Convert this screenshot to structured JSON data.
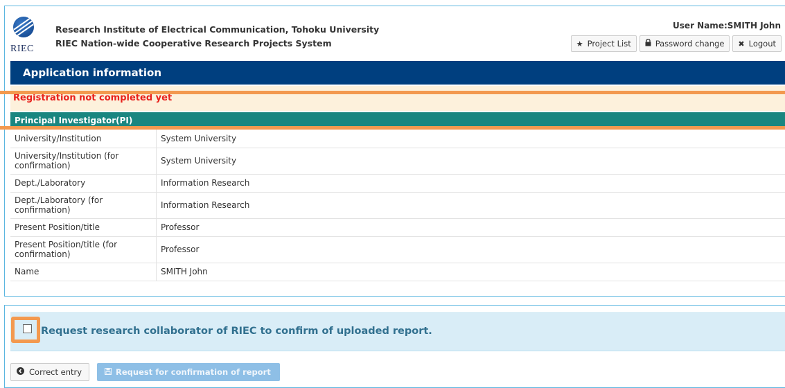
{
  "header": {
    "logo_text": "RIEC",
    "institute": "Research Institute of Electrical Communication, Tohoku University",
    "system_name": "RIEC Nation-wide Cooperative Research Projects System",
    "user_label": "User Name:SMITH John",
    "buttons": {
      "project_list": "Project List",
      "password_change": "Password change",
      "logout": "Logout"
    },
    "icons": {
      "project_list": "star-icon",
      "password_change": "lock-icon",
      "logout": "close-icon"
    }
  },
  "page_title": "Application information",
  "warning": "Registration not completed yet",
  "section_title": "Principal Investigator(PI)",
  "rows": [
    {
      "label": "University/Institution",
      "value": "System University"
    },
    {
      "label": "University/Institution (for confirmation)",
      "value": "System University"
    },
    {
      "label": "Dept./Laboratory",
      "value": "Information Research"
    },
    {
      "label": "Dept./Laboratory (for confirmation)",
      "value": "Information Research"
    },
    {
      "label": "Present Position/title",
      "value": "Professor"
    },
    {
      "label": "Present Position/title (for confirmation)",
      "value": "Professor"
    },
    {
      "label": "Name",
      "value": "SMITH John"
    }
  ],
  "request": {
    "checkbox_label": "Request research collaborator of RIEC to confirm of uploaded report.",
    "checked": false
  },
  "actions": {
    "correct_entry": "Correct entry",
    "request_confirmation": "Request for confirmation of report"
  },
  "colors": {
    "title_bar": "#003f7f",
    "section_bar": "#1a8680",
    "warning_text": "#e8211c",
    "highlight": "#f3994f",
    "request_bg": "#d9edf7",
    "request_text": "#31708f"
  }
}
